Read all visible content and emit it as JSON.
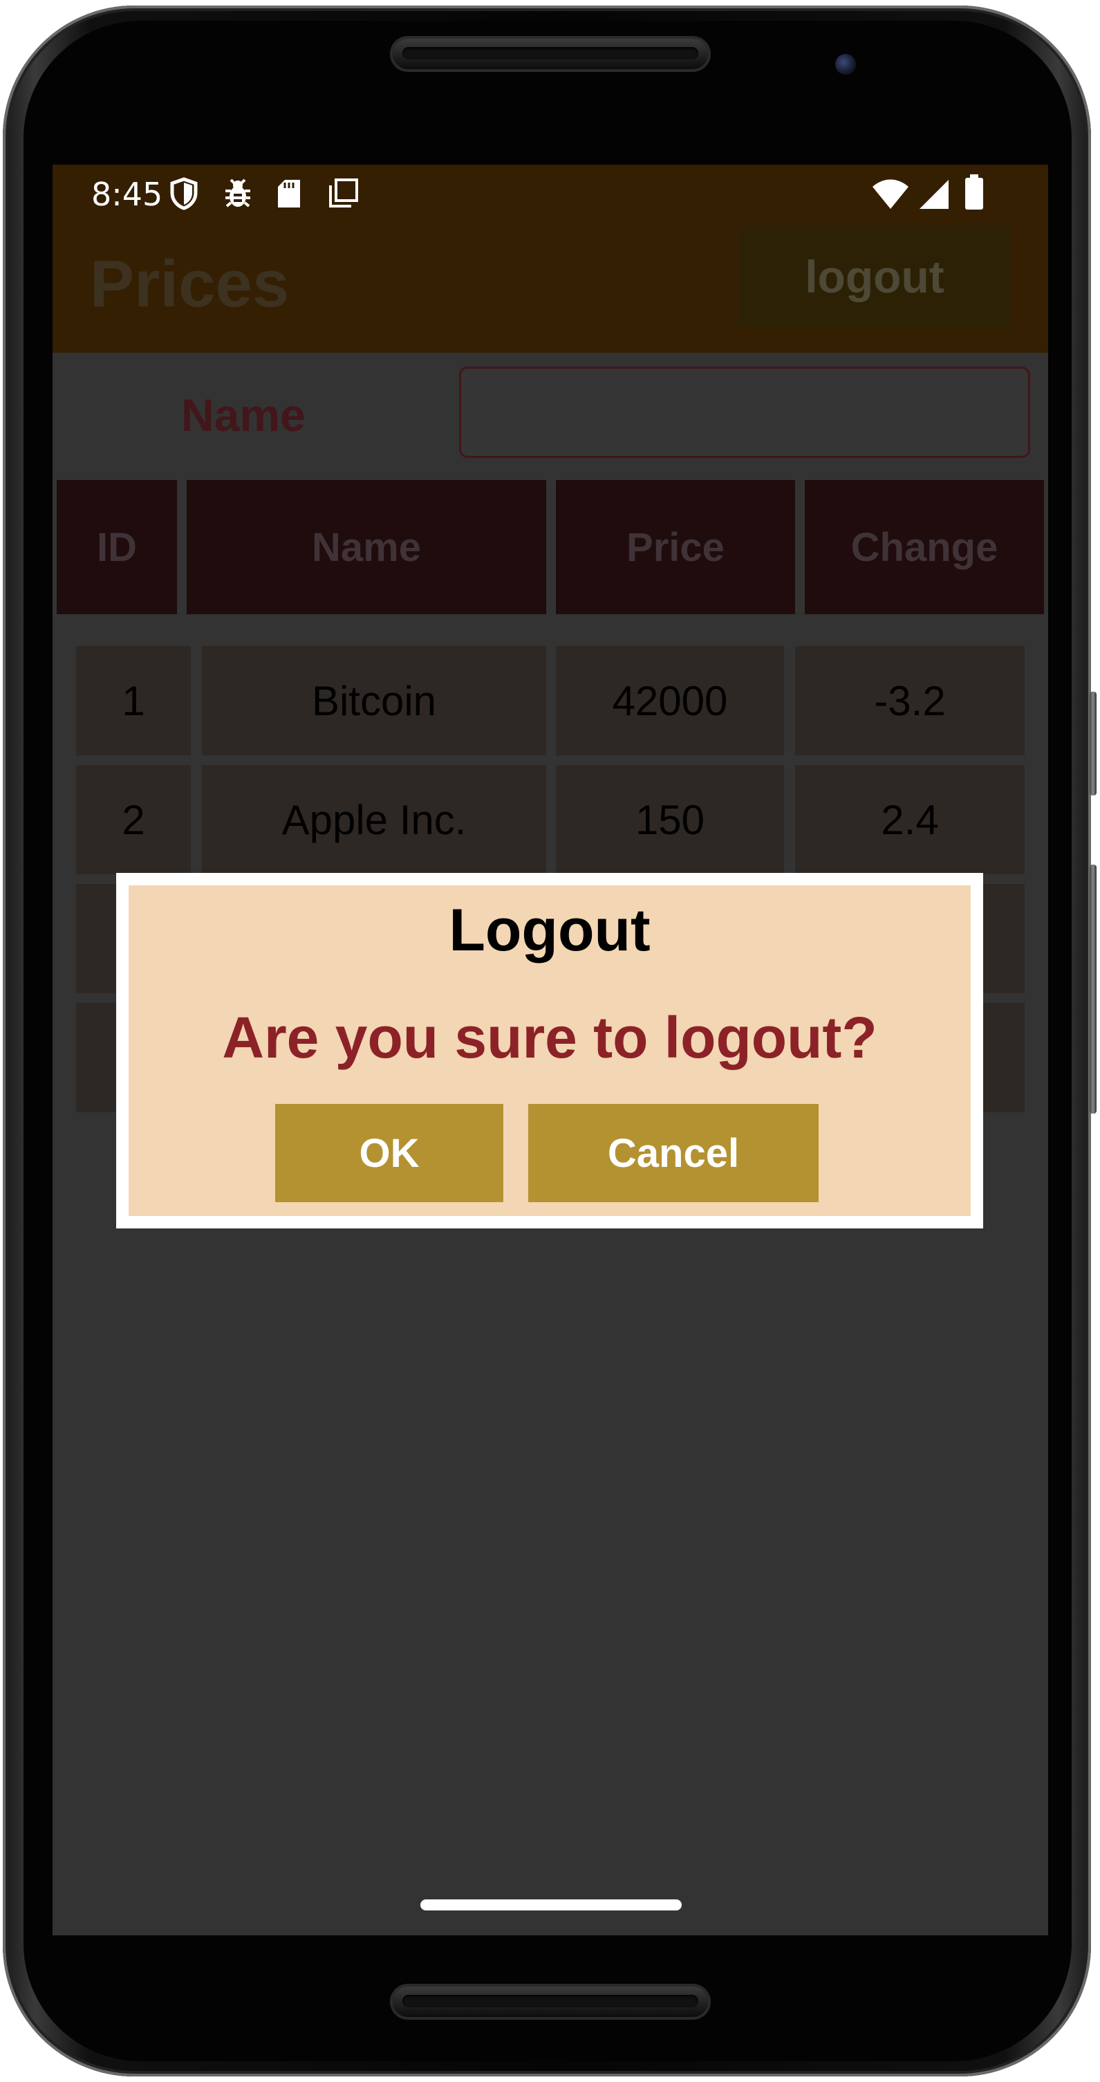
{
  "status_bar": {
    "time": "8:45",
    "left_icons": [
      "shield-icon",
      "bug-icon",
      "sd-card-icon",
      "screenshot-icon"
    ],
    "right_icons": [
      "wifi-icon",
      "cell-signal-icon",
      "battery-icon"
    ]
  },
  "app_bar": {
    "title": "Prices",
    "logout_label": "logout",
    "background": "#341f03"
  },
  "filter": {
    "name_label": "Name",
    "name_value": "",
    "name_placeholder": ""
  },
  "table": {
    "headers": [
      "ID",
      "Name",
      "Price",
      "Change"
    ],
    "rows": [
      [
        "1",
        "Bitcoin",
        "42000",
        "-3.2"
      ],
      [
        "2",
        "Apple Inc.",
        "150",
        "2.4"
      ],
      [
        "",
        "",
        "",
        ""
      ],
      [
        "",
        "",
        "",
        ""
      ]
    ]
  },
  "dialog": {
    "title": "Logout",
    "message": "Are you sure to logout?",
    "ok_label": "OK",
    "cancel_label": "Cancel",
    "background": "#f3d6b3",
    "message_color": "#8c2228",
    "button_color": "#b49232"
  }
}
